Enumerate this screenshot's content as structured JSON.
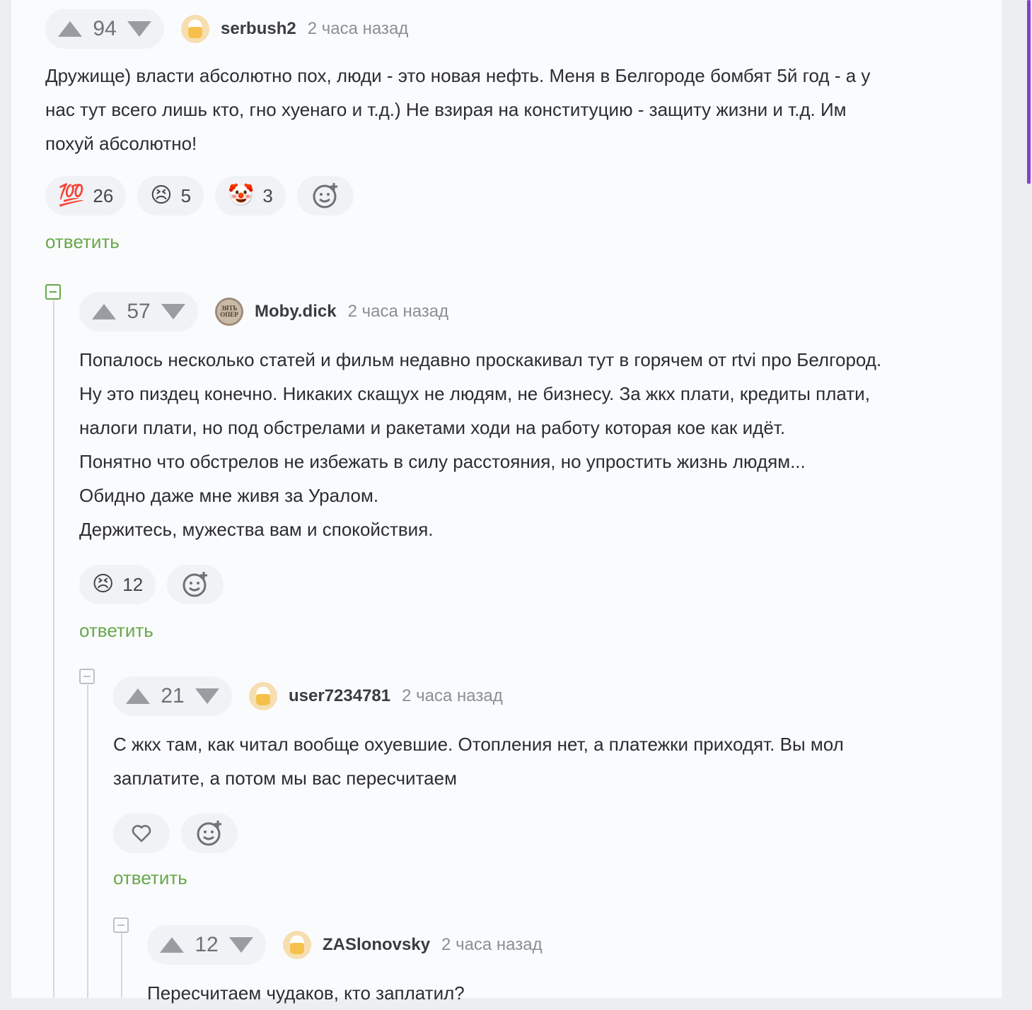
{
  "comments": [
    {
      "score": "94",
      "author": "serbush2",
      "time": "2 часа назад",
      "text": "Дружище) власти абсолютно пох, люди - это новая нефть. Меня в Белгороде бомбят 5й год - а у\nнас тут всего лишь кто, гно хуенаго и т.д.) Не взирая на конституцию - защиту жизни и т.д. Им\nпохуй абсолютно!",
      "reactions": [
        {
          "emoji": "💯",
          "count": "26"
        },
        {
          "emoji": "😣",
          "count": "5"
        },
        {
          "emoji": "🤡",
          "count": "3"
        }
      ],
      "reply_label": "ответить"
    },
    {
      "score": "57",
      "author": "Moby.dick",
      "time": "2 часа назад",
      "avatar_text": "ЗЯТЬ ОПЕР",
      "text": "Попалось несколько статей и фильм недавно проскакивал тут в горячем от rtvi про Белгород.\nНу это пиздец конечно. Никаких скащух не людям, не бизнесу. За жкх плати, кредиты плати,\nналоги плати, но под обстрелами и ракетами ходи на работу которая кое как идёт.\nПонятно что обстрелов не избежать в силу расстояния, но упростить жизнь людям...\nОбидно даже мне живя за Уралом.\nДержитесь, мужества вам и спокойствия.",
      "reactions": [
        {
          "emoji": "😣",
          "count": "12"
        }
      ],
      "reply_label": "ответить"
    },
    {
      "score": "21",
      "author": "user7234781",
      "time": "2 часа назад",
      "text": "С жкх там, как читал вообще охуевшие. Отопления нет, а платежки приходят. Вы мол\nзаплатите, а потом мы вас пересчитаем",
      "reply_label": "ответить"
    },
    {
      "score": "12",
      "author": "ZASlonovsky",
      "time": "2 часа назад",
      "text": "Пересчитаем чудаков, кто заплатил?"
    }
  ],
  "icons": {
    "upvote": "triangle-up-icon",
    "downvote": "triangle-down-icon",
    "add_reaction": "smiley-plus-icon",
    "like": "heart-icon",
    "collapse": "minus-square-icon"
  },
  "colors": {
    "reply": "#67a84a",
    "accent_scroll": "#8a3fd1"
  }
}
